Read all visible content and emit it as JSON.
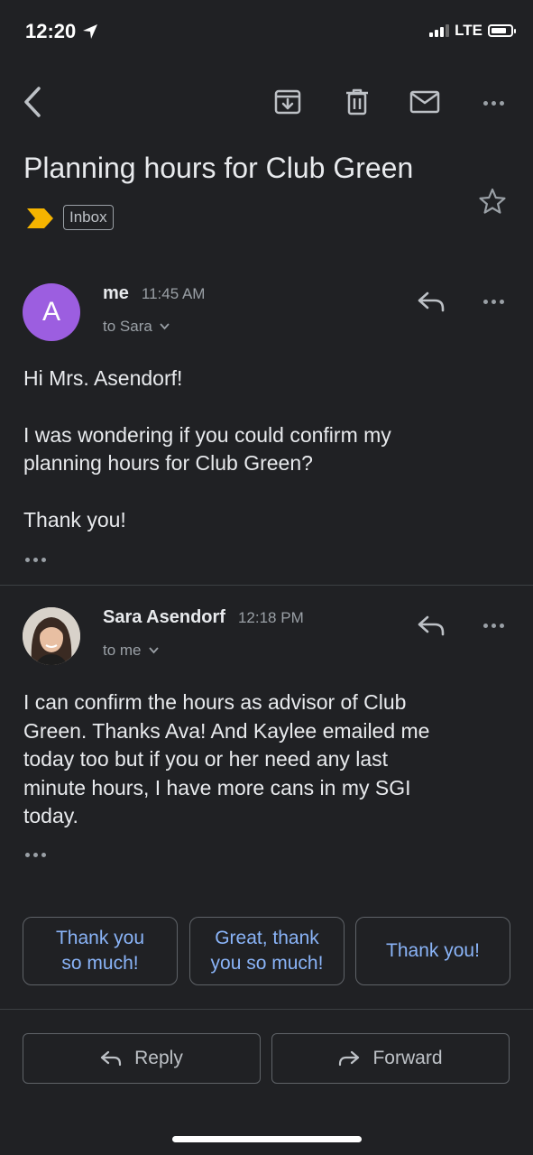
{
  "status_bar": {
    "time": "12:20",
    "network": "LTE"
  },
  "labels": {
    "inbox": "Inbox"
  },
  "subject": "Planning hours for Club Green",
  "messages": [
    {
      "avatar_letter": "A",
      "sender": "me",
      "time": "11:45 AM",
      "recipient": "to Sara",
      "body": [
        "Hi Mrs. Asendorf!",
        "I was wondering if you could confirm my",
        "planning hours for Club Green?",
        "Thank you!"
      ]
    },
    {
      "sender": "Sara Asendorf",
      "time": "12:18 PM",
      "recipient": "to me",
      "body": [
        "I can confirm the hours as advisor of Club",
        "Green. Thanks Ava! And Kaylee emailed me",
        "today too but if you or her need any last",
        "minute hours, I have more cans in my SGI",
        "today."
      ]
    }
  ],
  "smart_replies": [
    {
      "line1": "Thank you",
      "line2": "so much!"
    },
    {
      "line1": "Great, thank",
      "line2": "you so much!"
    },
    {
      "line1": "Thank you!"
    }
  ],
  "actions": {
    "reply": "Reply",
    "forward": "Forward"
  },
  "colors": {
    "background": "#202124",
    "accent": "#8ab4f8",
    "avatar": "#9c5ee0",
    "importance": "#f5b400"
  }
}
